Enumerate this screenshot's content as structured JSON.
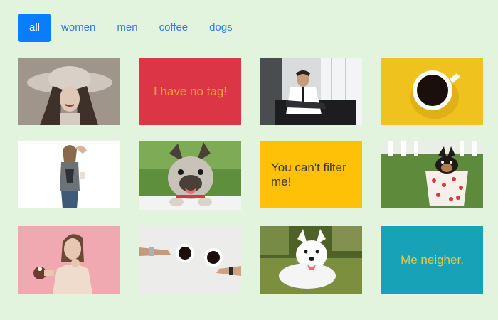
{
  "filters": [
    {
      "label": "all",
      "active": true
    },
    {
      "label": "women",
      "active": false
    },
    {
      "label": "men",
      "active": false
    },
    {
      "label": "coffee",
      "active": false
    },
    {
      "label": "dogs",
      "active": false
    }
  ],
  "cards": {
    "no_tag": {
      "text": "I have no tag!",
      "bg": "#dc3545",
      "color": "#f2a23a"
    },
    "cant_filter": {
      "text": "You can't filter me!",
      "bg": "#ffc107",
      "color": "#3b3b3b"
    },
    "neighbor": {
      "text": "Me neigher.",
      "bg": "#17a2b8",
      "color": "#e8c64a"
    }
  },
  "colors": {
    "accent": "#0a7cff",
    "link": "#2f7de1",
    "background": "#e2f4dd"
  },
  "photos": [
    {
      "name": "woman-hat-photo"
    },
    {
      "name": "man-window-photo"
    },
    {
      "name": "coffee-yellow-photo"
    },
    {
      "name": "woman-standing-photo"
    },
    {
      "name": "french-bulldog-photo"
    },
    {
      "name": "puppy-cup-photo"
    },
    {
      "name": "woman-pink-photo"
    },
    {
      "name": "coffee-cups-photo"
    },
    {
      "name": "white-dog-photo"
    }
  ]
}
